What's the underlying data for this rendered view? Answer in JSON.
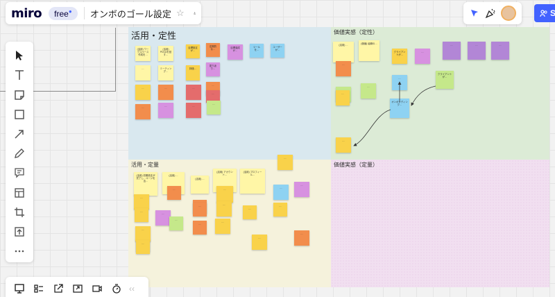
{
  "app": {
    "logo_text": "miro",
    "plan_badge": "free",
    "board_title": "オンボのゴール設定"
  },
  "colors": {
    "accent": "#4262ff",
    "logo": "#050038"
  },
  "share_button": {
    "label": "S"
  },
  "toolbar": {
    "tools": [
      {
        "id": "select",
        "icon": "cursor-icon"
      },
      {
        "id": "text",
        "icon": "text-icon"
      },
      {
        "id": "sticky",
        "icon": "sticky-note-icon"
      },
      {
        "id": "shape",
        "icon": "square-icon"
      },
      {
        "id": "line",
        "icon": "arrow-icon"
      },
      {
        "id": "pen",
        "icon": "pen-icon"
      },
      {
        "id": "comment",
        "icon": "comment-icon"
      },
      {
        "id": "frame",
        "icon": "frame-icon"
      },
      {
        "id": "crop",
        "icon": "crop-icon"
      },
      {
        "id": "upload",
        "icon": "upload-icon"
      },
      {
        "id": "more",
        "icon": "more-icon"
      }
    ]
  },
  "bottom_toolbar": {
    "tools": [
      {
        "id": "presentation",
        "icon": "presentation-icon"
      },
      {
        "id": "kanban",
        "icon": "kanban-icon"
      },
      {
        "id": "share-out",
        "icon": "external-link-icon"
      },
      {
        "id": "screen",
        "icon": "screen-share-icon"
      },
      {
        "id": "video",
        "icon": "video-icon"
      },
      {
        "id": "timer",
        "icon": "timer-icon"
      }
    ],
    "collapse_label": "‹‹"
  },
  "frames": [
    {
      "id": "usage-qualitative",
      "label": "活用・定性",
      "big": true,
      "color": "#d9e8ef"
    },
    {
      "id": "value-qualitative",
      "label": "価値実感（定性）",
      "big": false,
      "color": "#dcebd6"
    },
    {
      "id": "usage-quantitative",
      "label": "活用・定量",
      "big": false,
      "color": "#f5f2dc"
    },
    {
      "id": "value-quantitative",
      "label": "価値実感（定量）",
      "big": false,
      "color": "#f1dff0"
    }
  ],
  "stickies": [
    {
      "t": "(活用) ワークスペース作成を…",
      "c": "#fff6a6"
    },
    {
      "t": "(活用) PDCAを回す…",
      "c": "#fff6a6"
    },
    {
      "t": "目標設定が…",
      "c": "#f9d24a"
    },
    {
      "t": "定期的な…",
      "c": "#f28d4c"
    },
    {
      "t": "目標達成が…",
      "c": "#d791e0"
    },
    {
      "t": "ツールを…",
      "c": "#8ed2f2"
    },
    {
      "t": "ユーザーが…",
      "c": "#8ed2f2"
    },
    {
      "t": "…",
      "c": "#fff6a6"
    },
    {
      "t": "ミーティング…",
      "c": "#fff6a6"
    },
    {
      "t": "評価…",
      "c": "#f9d24a"
    },
    {
      "t": "振り返り…",
      "c": "#d791e0"
    },
    {
      "t": "…",
      "c": "#f9d24a"
    },
    {
      "t": "…",
      "c": "#f28d4c"
    },
    {
      "t": "…",
      "c": "#f28d4c"
    },
    {
      "t": "…",
      "c": "#e46c6c"
    },
    {
      "t": "…",
      "c": "#f28d4c"
    },
    {
      "t": "…",
      "c": "#d791e0"
    },
    {
      "t": "…",
      "c": "#e46c6c"
    },
    {
      "t": "…",
      "c": "#e46c6c"
    },
    {
      "t": "…",
      "c": "#c5e88a"
    },
    {
      "t": "(活用) …",
      "c": "#fff6a6"
    },
    {
      "t": "…",
      "c": "#f28d4c"
    },
    {
      "t": "(価値) 組織の…",
      "c": "#fff6a6"
    },
    {
      "t": "クライアントが…",
      "c": "#f9d24a"
    },
    {
      "t": "…",
      "c": "#d791e0"
    },
    {
      "t": "…",
      "c": "#b286d6"
    },
    {
      "t": "…",
      "c": "#b286d6"
    },
    {
      "t": "…",
      "c": "#b286d6"
    },
    {
      "t": "…",
      "c": "#c5e88a"
    },
    {
      "t": "…",
      "c": "#8ed2f2"
    },
    {
      "t": "クライアントが…",
      "c": "#c5e88a"
    },
    {
      "t": "…",
      "c": "#c5e88a"
    },
    {
      "t": "オンボーディング…",
      "c": "#8ed2f2"
    },
    {
      "t": "…",
      "c": "#f9d24a"
    },
    {
      "t": "…",
      "c": "#f9d24a"
    },
    {
      "t": "(活用) 初期設定が完了し、ページを出…",
      "c": "#fff6a6"
    },
    {
      "t": "(活用) …",
      "c": "#fff6a6"
    },
    {
      "t": "(活用) …",
      "c": "#fff6a6"
    },
    {
      "t": "(活用) アカウント…",
      "c": "#fff6a6"
    },
    {
      "t": "(活用) プロフィール…",
      "c": "#fff6a6"
    },
    {
      "t": "…",
      "c": "#f28d4c"
    },
    {
      "t": "…",
      "c": "#f9d24a"
    },
    {
      "t": "…",
      "c": "#f9d24a"
    },
    {
      "t": "…",
      "c": "#f28d4c"
    },
    {
      "t": "…",
      "c": "#f9d24a"
    },
    {
      "t": "…",
      "c": "#8ed2f2"
    },
    {
      "t": "…",
      "c": "#d791e0"
    },
    {
      "t": "…",
      "c": "#f9d24a"
    },
    {
      "t": "…",
      "c": "#f28d4c"
    },
    {
      "t": "…",
      "c": "#f9d24a"
    },
    {
      "t": "…",
      "c": "#f28d4c"
    },
    {
      "t": "…",
      "c": "#f28d4c"
    },
    {
      "t": "…",
      "c": "#f9d24a"
    },
    {
      "t": "…",
      "c": "#d791e0"
    },
    {
      "t": "…",
      "c": "#f9d24a"
    },
    {
      "t": "…",
      "c": "#c5e88a"
    },
    {
      "t": "…",
      "c": "#f9d24a"
    },
    {
      "t": "…",
      "c": "#f9d24a"
    },
    {
      "t": "…",
      "c": "#f9d24a"
    },
    {
      "t": "…",
      "c": "#f28d4c"
    },
    {
      "t": "…",
      "c": "#f9d24a"
    }
  ]
}
